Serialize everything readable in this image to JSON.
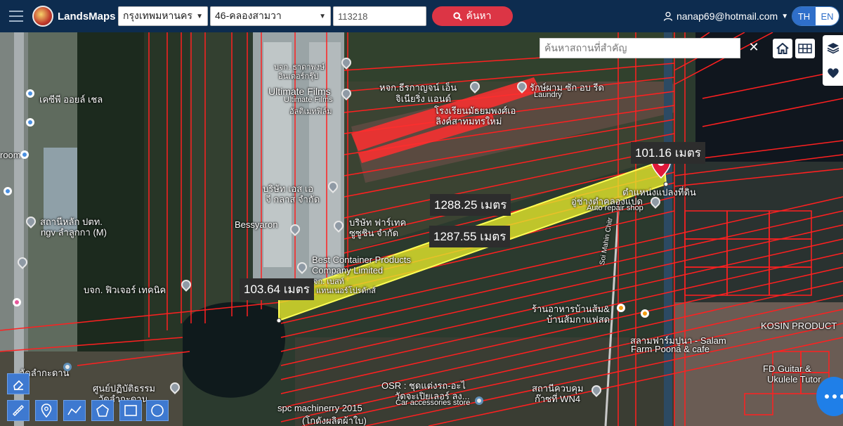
{
  "header": {
    "brand": "LandsMaps",
    "province": "กรุงเทพมหานคร",
    "district": "46-คลองสามวา",
    "parcel_number": "113218",
    "search_label": "ค้นหา",
    "user_email": "nanap69@hotmail.com",
    "lang_th": "TH",
    "lang_en": "EN"
  },
  "map": {
    "place_search_placeholder": "ค้นหาสถานที่สำคัญ",
    "measurements": {
      "top_edge": "101.16 เมตร",
      "north_edge": "1288.25 เมตร",
      "south_edge": "1287.55 เมตร",
      "west_edge": "103.64 เมตร"
    },
    "labels": [
      {
        "id": "shell",
        "text": "เคซีพี ออยล์ เชล"
      },
      {
        "id": "ultimate1",
        "text": "Ultimate Films"
      },
      {
        "id": "ultimate2",
        "text": "Ultimate Films"
      },
      {
        "id": "ultimate3",
        "text": "อัลติเมทฟิล์ม"
      },
      {
        "id": "kitchen",
        "text": "หจก.ธีรกาญจน์ เอ็น"
      },
      {
        "id": "kitchen2",
        "text": "จิเนียริ่ง แอนด์"
      },
      {
        "id": "laundry",
        "text": "รักษ์ผาม ซัก อบ รีด"
      },
      {
        "id": "laundry2",
        "text": "Laundry"
      },
      {
        "id": "fsp",
        "text": "โรงเรียนมัธยมพงศ์เอ"
      },
      {
        "id": "fsp2",
        "text": "ลิงค์สาทมทรใหม่"
      },
      {
        "id": "bangchak",
        "text": "บริษัท เอส เอ"
      },
      {
        "id": "bangchak2",
        "text": "จี กลาส จำกัด"
      },
      {
        "id": "station",
        "text": "สถานีหลัก ปตท."
      },
      {
        "id": "station2",
        "text": "ngv ลำลูกกา (M)"
      },
      {
        "id": "bessy",
        "text": "Bessyaron"
      },
      {
        "id": "pharma",
        "text": "บริษัท ฟาร์เทค"
      },
      {
        "id": "pharma2",
        "text": "ซูซูชิน จำกัด"
      },
      {
        "id": "best",
        "text": "Best Container Products"
      },
      {
        "id": "best2",
        "text": "Company Limited"
      },
      {
        "id": "best3",
        "text": "จก. เบสท์"
      },
      {
        "id": "best4",
        "text": "แทนเนอร์โปรดักส์"
      },
      {
        "id": "future",
        "text": "บจก. ฟิวเจอร์ เทคนิค"
      },
      {
        "id": "repair",
        "text": "อู่ช่างตำคลองแปด"
      },
      {
        "id": "repair2",
        "text": "Auto repair shop"
      },
      {
        "id": "landmark",
        "text": "ตำแหน่งแปลงที่ดิน"
      },
      {
        "id": "restaurant",
        "text": "ร้านอาหารบ้านส้ม&"
      },
      {
        "id": "restaurant2",
        "text": "บ้านส้มกาแฟสด"
      },
      {
        "id": "farm",
        "text": "สลามฟาร์มปูนา - Salam"
      },
      {
        "id": "farm2",
        "text": "Farm Poona & cafe"
      },
      {
        "id": "kosin",
        "text": "KOSIN PRODUCT"
      },
      {
        "id": "guitar",
        "text": "FD Guitar &"
      },
      {
        "id": "guitar2",
        "text": "Ukulele Tutor"
      },
      {
        "id": "osr",
        "text": "OSR : ชุดแต่งรถ-อะไ"
      },
      {
        "id": "osr2",
        "text": "วัดจะเปิยเลอร์ ลง..."
      },
      {
        "id": "osr3",
        "text": "Car accessories store"
      },
      {
        "id": "control",
        "text": "สถานีควบคุม"
      },
      {
        "id": "control2",
        "text": "ก๊าซที่ WN4"
      },
      {
        "id": "spc",
        "text": "spc machinerry 2015"
      },
      {
        "id": "spc2",
        "text": "(โกดังผลิตผ้าใบ)"
      },
      {
        "id": "center",
        "text": "ศูนย์ปฏิบัติธรรม"
      },
      {
        "id": "center2",
        "text": "วัดลำกะดาน"
      },
      {
        "id": "temple",
        "text": "วัดลำกะดาน"
      },
      {
        "id": "room",
        "text": "room"
      },
      {
        "id": "soi",
        "text": "Soi Mahin Chitr"
      },
      {
        "id": "rkt",
        "text": "บจก. ธาดาพงษ์"
      },
      {
        "id": "rkt2",
        "text": "อินเตอร์กรุ๊ป"
      }
    ]
  },
  "colors": {
    "topbar": "#0d2c4f",
    "parcel_highlight": "#e5e82a",
    "parcel_line": "#ff2020",
    "search_button": "#dc3545",
    "lang_active": "#2f6fca",
    "tool_button": "#3e79d0"
  },
  "icons": {
    "menu": "hamburger-icon",
    "search": "magnifier-icon",
    "user": "user-icon",
    "home": "home-icon",
    "grid": "grid-icon",
    "layers": "layers-icon",
    "favorite": "heart-icon",
    "tools": [
      "eraser-icon",
      "ruler-icon",
      "pin-icon",
      "polyline-icon",
      "polygon-icon",
      "rectangle-icon",
      "circle-icon"
    ]
  }
}
